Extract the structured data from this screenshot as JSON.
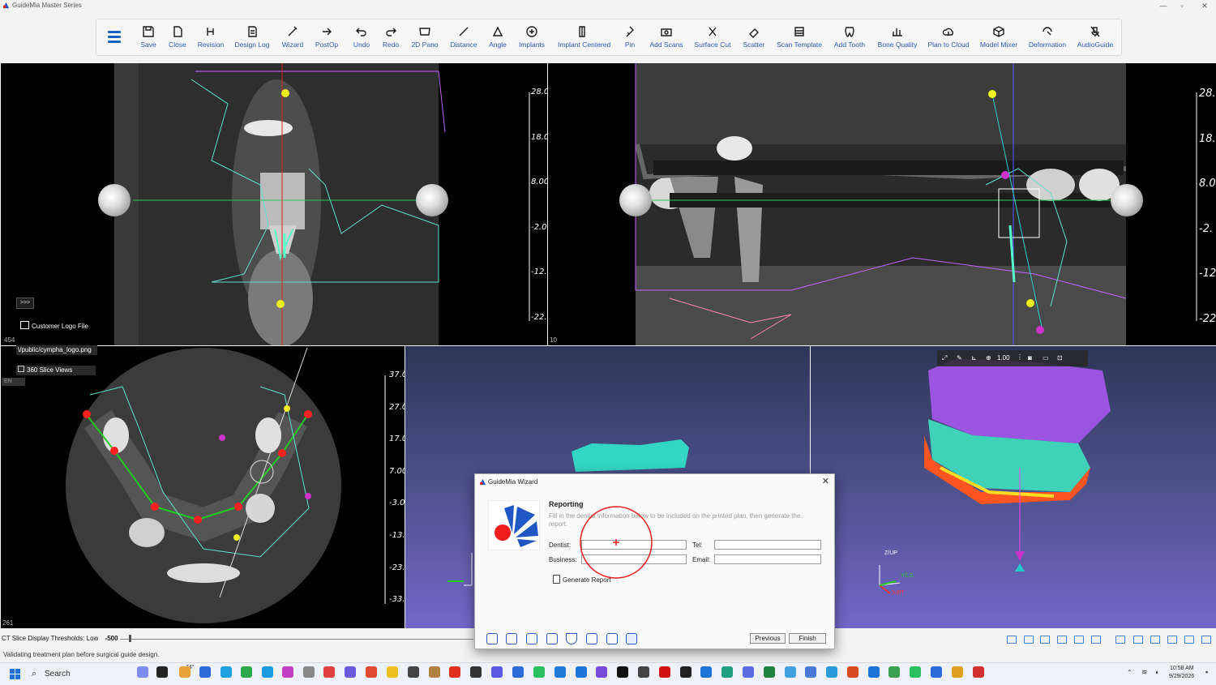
{
  "window": {
    "title": "GuideMia Master Series"
  },
  "toolbar": {
    "items": [
      {
        "label": "Save",
        "icon": "save-icon"
      },
      {
        "label": "Close",
        "icon": "close-file-icon"
      },
      {
        "label": "Revision",
        "icon": "revision-icon"
      },
      {
        "label": "Design Log",
        "icon": "design-log-icon"
      },
      {
        "label": "Wizard",
        "icon": "wizard-icon"
      },
      {
        "label": "PostOp",
        "icon": "postop-icon"
      },
      {
        "label": "Undo",
        "icon": "undo-icon"
      },
      {
        "label": "Redo",
        "icon": "redo-icon"
      },
      {
        "label": "2D Pano",
        "icon": "pano-icon"
      },
      {
        "label": "Distance",
        "icon": "distance-icon"
      },
      {
        "label": "Angle",
        "icon": "angle-icon"
      },
      {
        "label": "Implants",
        "icon": "implants-icon"
      },
      {
        "label": "Implant Centered",
        "icon": "implant-centered-icon"
      },
      {
        "label": "Pin",
        "icon": "pin-icon"
      },
      {
        "label": "Add Scans",
        "icon": "add-scans-icon"
      },
      {
        "label": "Surface Cut",
        "icon": "surface-cut-icon"
      },
      {
        "label": "Scatter",
        "icon": "scatter-icon"
      },
      {
        "label": "Scan Template",
        "icon": "scan-template-icon"
      },
      {
        "label": "Add Tooth",
        "icon": "add-tooth-icon"
      },
      {
        "label": "Bone Quality",
        "icon": "bone-quality-icon"
      },
      {
        "label": "Plan to Cloud",
        "icon": "cloud-icon"
      },
      {
        "label": "Model Mixer",
        "icon": "model-mixer-icon"
      },
      {
        "label": "Deformation",
        "icon": "deformation-icon"
      },
      {
        "label": "AudioGuide",
        "icon": "audio-guide-icon"
      }
    ]
  },
  "views": {
    "cross": {
      "ruler": [
        "28.0",
        "18.0",
        "8.00",
        "-2.0",
        "-12.",
        "-22."
      ],
      "slice": "454"
    },
    "pano": {
      "ruler": [
        "28.",
        "18.",
        "8.0",
        "-2.",
        "-12",
        "-22"
      ],
      "slice": "10"
    },
    "axial": {
      "ruler": [
        "37.0",
        "27.0",
        "17.0",
        "7.00",
        "-3.0",
        "-13.",
        "-23.",
        "-33."
      ],
      "slice": "261"
    },
    "overlay": {
      "expand": ">>>",
      "logo_label": "Customer Logo File",
      "logo_path": "\\/public/cympha_logo.png",
      "slice_views": "360 Slice Views",
      "lang": "EN"
    },
    "view3d": {
      "zoom": "1.00",
      "axis_z": "Z/UP",
      "axis_y": "Y/LG",
      "axis_x": "X/RT"
    }
  },
  "status": {
    "threshold_label": "CT Slice Display Thresholds: Low",
    "threshold_value": "-500",
    "message": "Validating treatment plan before surgical guide design."
  },
  "dialog": {
    "title": "GuideMia Wizard",
    "heading": "Reporting",
    "description": "Fill in the dentist information below to be included on the printed plan, then generate the report.",
    "fields": {
      "dentist": "Dentist:",
      "business": "Business:",
      "tel": "Tel:",
      "email": "Email:"
    },
    "generate": "Generate Report",
    "previous": "Previous",
    "finish": "Finish"
  },
  "taskbar": {
    "search": "Search",
    "weather": "74°",
    "time": "10:58 AM",
    "date": "9/29/2026"
  }
}
